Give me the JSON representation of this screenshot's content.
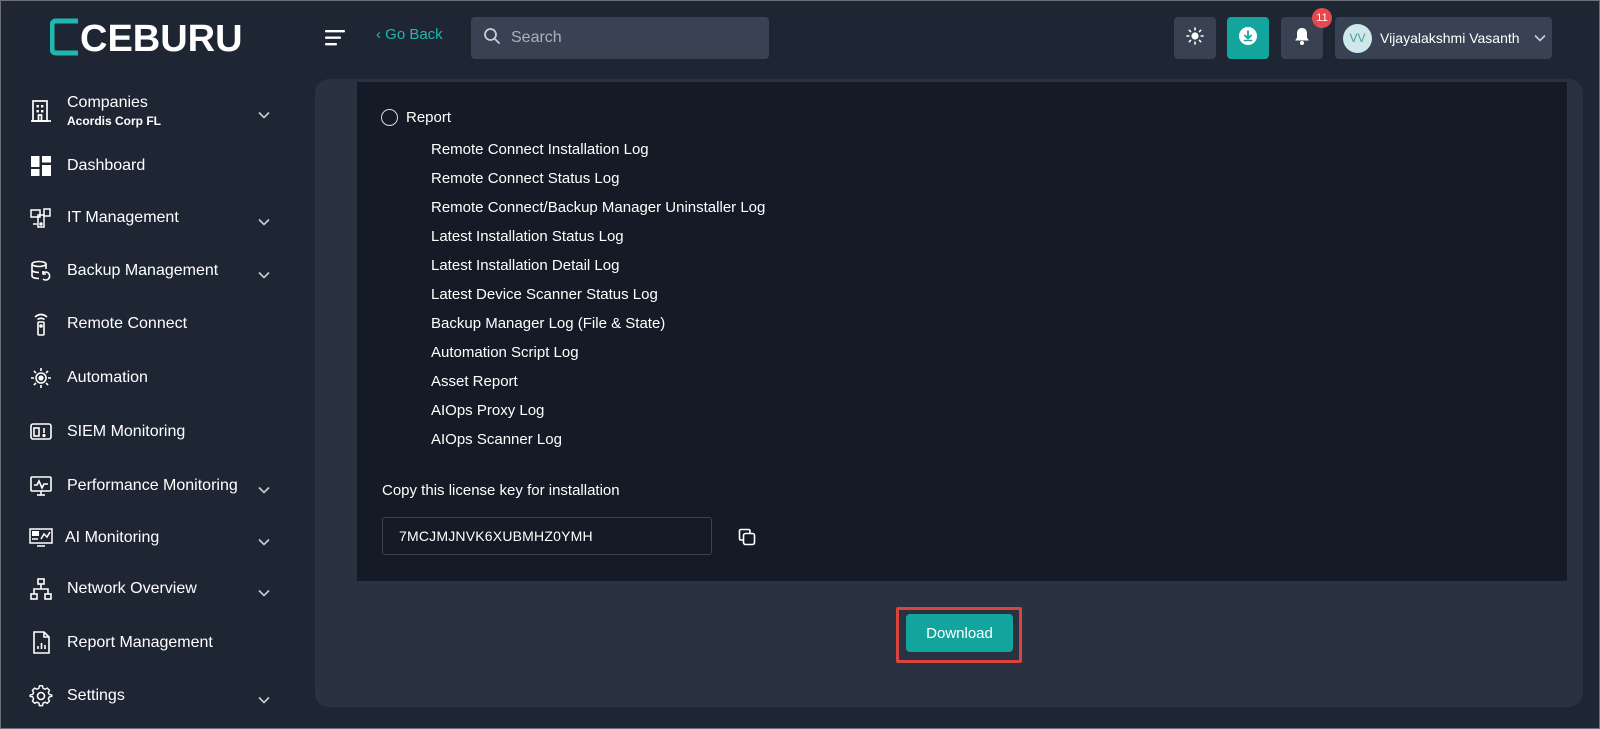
{
  "header": {
    "logo_text": "CEBURU",
    "go_back": "‹ Go Back",
    "search_placeholder": "Search",
    "notification_count": "11",
    "user": {
      "initials": "VV",
      "name": "Vijayalakshmi Vasanth"
    }
  },
  "sidebar": {
    "company": {
      "label": "Companies",
      "sub": "Acordis Corp FL"
    },
    "items": [
      {
        "label": "Dashboard",
        "icon": "dashboard-icon",
        "caret": false
      },
      {
        "label": "IT Management",
        "icon": "it-management-icon",
        "caret": true
      },
      {
        "label": "Backup Management",
        "icon": "backup-icon",
        "caret": true
      },
      {
        "label": "Remote Connect",
        "icon": "remote-icon",
        "caret": false
      },
      {
        "label": "Automation",
        "icon": "automation-icon",
        "caret": false
      },
      {
        "label": "SIEM Monitoring",
        "icon": "siem-icon",
        "caret": false
      },
      {
        "label": "Performance Monitoring",
        "icon": "performance-icon",
        "caret": true
      },
      {
        "label": "AI Monitoring",
        "icon": "ai-monitor-icon",
        "caret": true
      },
      {
        "label": "Network Overview",
        "icon": "network-icon",
        "caret": true
      },
      {
        "label": "Report Management",
        "icon": "report-icon",
        "caret": false
      },
      {
        "label": "Settings",
        "icon": "settings-icon",
        "caret": true
      }
    ]
  },
  "main": {
    "radio_label": "Report",
    "logs": [
      "Remote Connect Installation Log",
      "Remote Connect Status Log",
      "Remote Connect/Backup Manager Uninstaller Log",
      "Latest Installation Status Log",
      "Latest Installation Detail Log",
      "Latest Device Scanner Status Log",
      "Backup Manager Log (File & State)",
      "Automation Script Log",
      "Asset Report",
      "AIOps Proxy Log",
      "AIOps Scanner Log"
    ],
    "license_label": "Copy this license key for installation",
    "license_key": "7MCJMJNVK6XUBMHZ0YMH",
    "download_label": "Download"
  },
  "colors": {
    "accent": "#14a49e",
    "background": "#1e2634",
    "panel": "#141a26",
    "badge": "#e5484d",
    "highlight": "#d9443e"
  }
}
